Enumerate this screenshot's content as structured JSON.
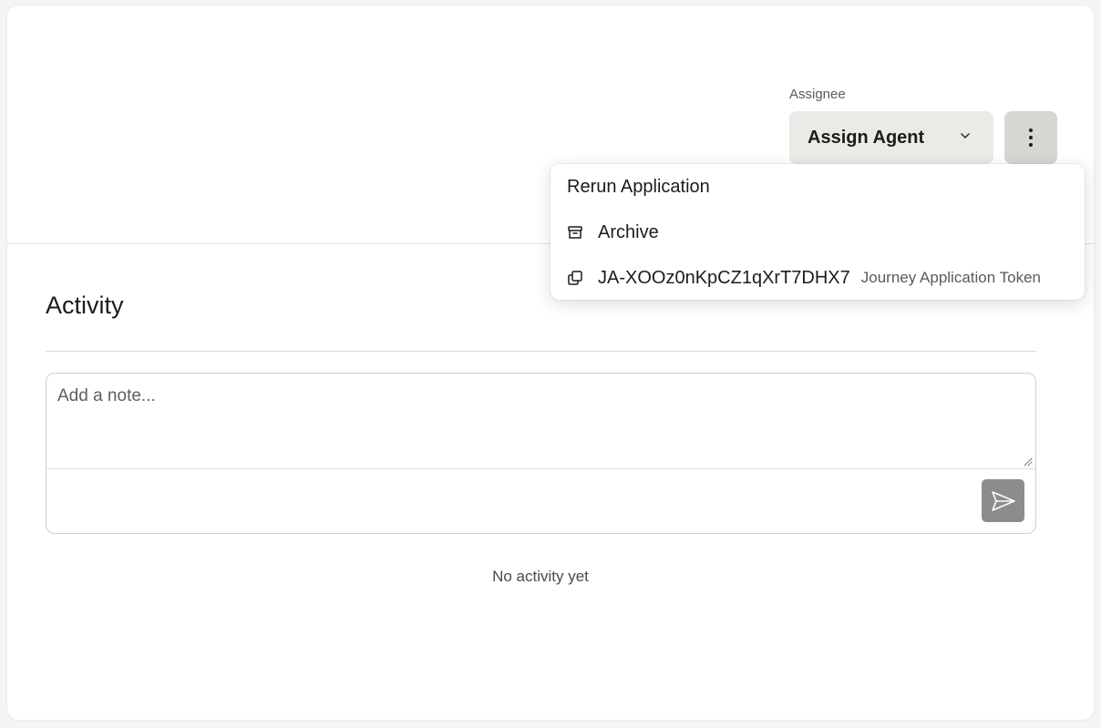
{
  "assignee": {
    "label": "Assignee",
    "button_label": "Assign Agent"
  },
  "menu": {
    "rerun_label": "Rerun Application",
    "archive_label": "Archive",
    "token_value": "JA-XOOz0nKpCZ1qXrT7DHX7",
    "token_caption": "Journey Application Token"
  },
  "activity": {
    "title": "Activity",
    "note_placeholder": "Add a note...",
    "empty_text": "No activity yet"
  },
  "icons": {
    "assign_dropdown": "chevron-down-icon",
    "more": "more-vertical-icon",
    "archive": "archive-icon",
    "copy": "copy-icon",
    "send": "send-icon"
  },
  "colors": {
    "assign_button_bg": "#ebeae6",
    "more_button_bg": "#d8d6d0",
    "send_button_bg": "#8d8c8a"
  }
}
